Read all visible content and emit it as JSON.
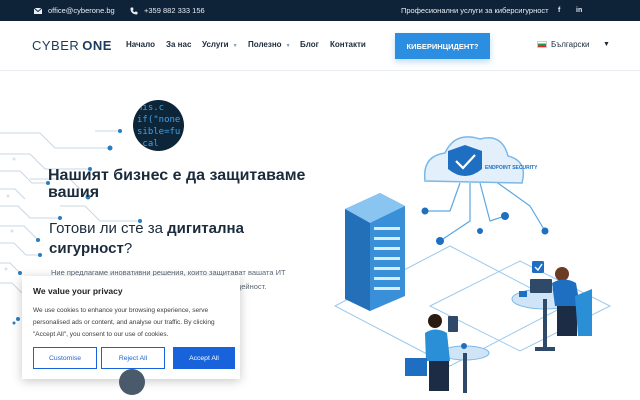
{
  "topbar": {
    "email": "office@cyberone.bg",
    "phone": "+359 882 333 156",
    "tagline": "Професионални услуги за киберсигурност",
    "social": [
      "f",
      "in"
    ]
  },
  "header": {
    "logo_part1": "CYBER",
    "logo_part2": "ONE",
    "nav": [
      {
        "label": "Начало",
        "has_dropdown": false
      },
      {
        "label": "За нас",
        "has_dropdown": false
      },
      {
        "label": "Услуги",
        "has_dropdown": true
      },
      {
        "label": "Полезно",
        "has_dropdown": true
      },
      {
        "label": "Блог",
        "has_dropdown": false
      },
      {
        "label": "Контакти",
        "has_dropdown": false
      }
    ],
    "cta_label": "КИБЕРИНЦИДЕНТ?",
    "language": "Български",
    "colors": {
      "accent": "#2b8ee0",
      "topbar": "#0e2238"
    }
  },
  "hero": {
    "code_snippet": "nis.c\nif(\"none\nsible=fu\n.cal",
    "title": "Нашият бизнес е да защитаваме вашия",
    "subtitle_prefix": "Готови ли сте за ",
    "subtitle_bold": "дигитална сигурност",
    "subtitle_suffix": "?",
    "text_line1": "Ние предлагаме иновативни решения, които защитават вашата ИТ",
    "text_line2": "с дейност.",
    "illustration_shield_label": "ENDPOINT SECURITY"
  },
  "cookie": {
    "title": "We value your privacy",
    "body": "We use cookies to enhance your browsing experience, serve personalised ads or content, and analyse our traffic. By clicking \"Accept All\", you consent to our use of cookies.",
    "customise": "Customise",
    "reject": "Reject All",
    "accept": "Accept All"
  }
}
